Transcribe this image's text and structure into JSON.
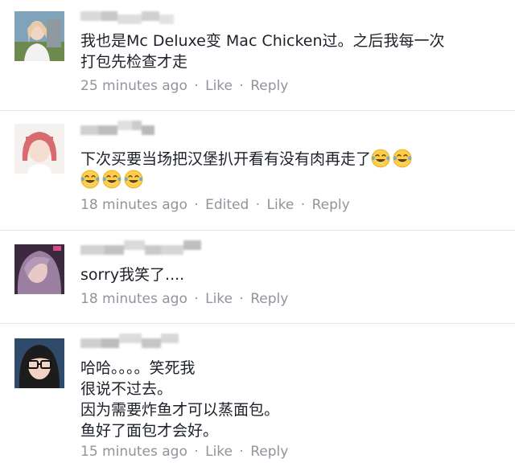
{
  "comments": [
    {
      "lines": [
        "我也是Mc Deluxe变 Mac Chicken过。之后我每一次",
        "打包先检查才走"
      ],
      "time": "25 minutes ago",
      "edited": "",
      "like": "Like",
      "reply": "Reply"
    },
    {
      "lines": [
        "下次买要当场把汉堡扒开看有没有肉再走了"
      ],
      "time": "18 minutes ago",
      "edited": "Edited",
      "like": "Like",
      "reply": "Reply"
    },
    {
      "lines": [
        "sorry我笑了...."
      ],
      "time": "18 minutes ago",
      "edited": "",
      "like": "Like",
      "reply": "Reply"
    },
    {
      "lines": [
        "哈哈。。。。笑死我",
        "很说不过去。",
        "因为需要炸鱼才可以蒸面包。",
        "鱼好了面包才会好。"
      ],
      "time": "15 minutes ago",
      "edited": "",
      "like": "Like",
      "reply": "Reply"
    }
  ],
  "icons": {
    "emoji": "face-with-tears-of-joy-icon"
  },
  "colors": {
    "text": "#1d2129",
    "meta": "#90949c",
    "divider": "#e5e6e9"
  }
}
